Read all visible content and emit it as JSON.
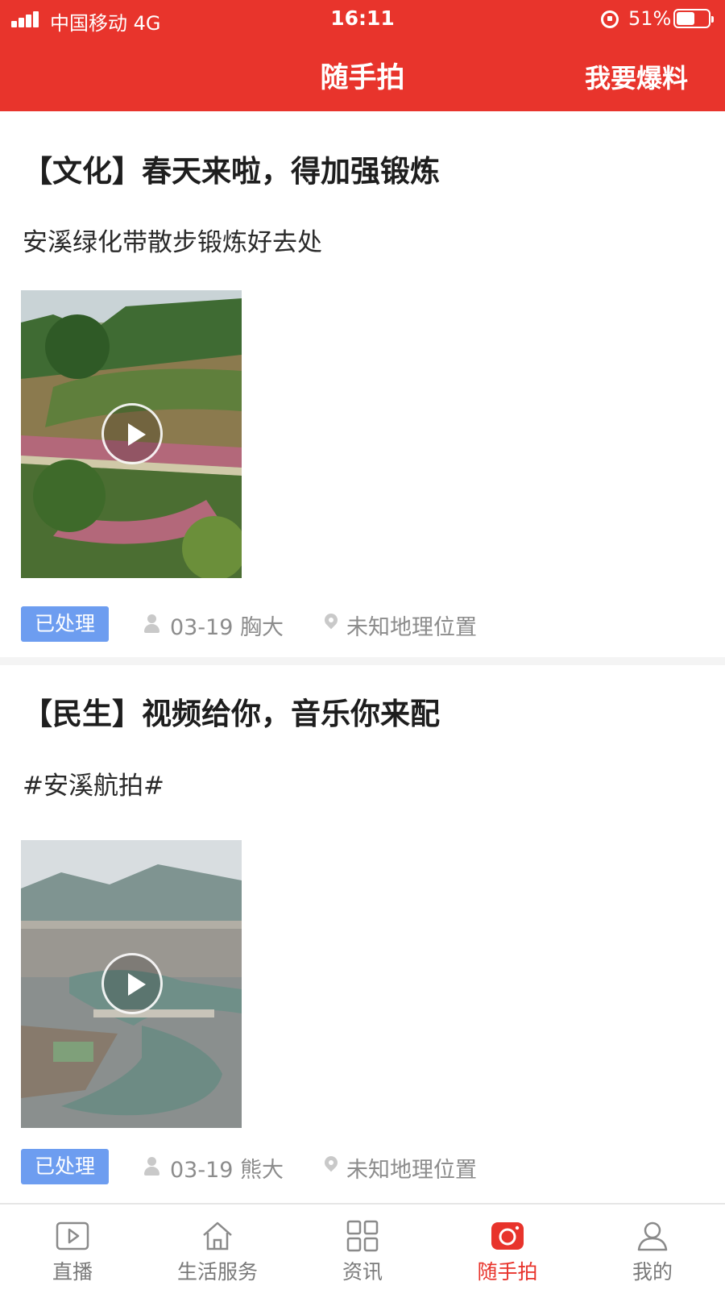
{
  "status_bar": {
    "carrier": "中国移动  4G",
    "time": "16:11",
    "battery": "51%"
  },
  "nav": {
    "title": "随手拍",
    "action": "我要爆料"
  },
  "posts": [
    {
      "title": "【文化】春天来啦，得加强锻炼",
      "description": "安溪绿化带散步锻炼好去处",
      "status": "已处理",
      "date_user": "03-19  胸大",
      "location": "未知地理位置"
    },
    {
      "title": "【民生】视频给你，音乐你来配",
      "description": "#安溪航拍#",
      "status": "已处理",
      "date_user": "03-19  熊大",
      "location": "未知地理位置"
    }
  ],
  "tabs": [
    {
      "label": "直播",
      "icon": "play-icon"
    },
    {
      "label": "生活服务",
      "icon": "home-icon"
    },
    {
      "label": "资讯",
      "icon": "grid-icon"
    },
    {
      "label": "随手拍",
      "icon": "camera-icon"
    },
    {
      "label": "我的",
      "icon": "profile-icon"
    }
  ],
  "colors": {
    "brand": "#e8342c",
    "badge": "#6d9df0",
    "meta_text": "#8c8c8c"
  }
}
